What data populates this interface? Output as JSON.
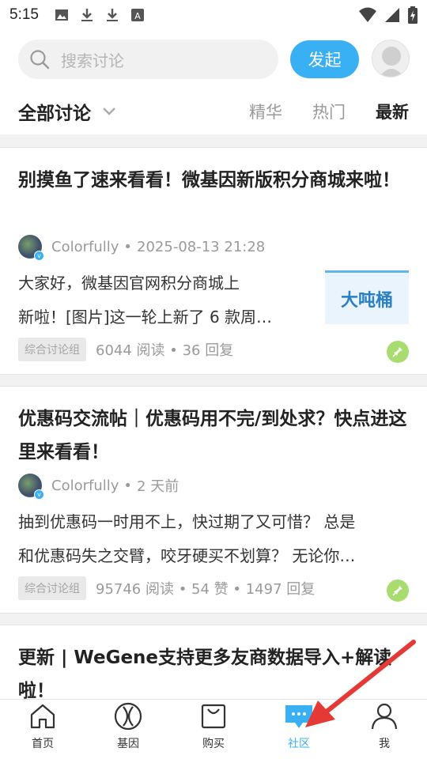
{
  "status_bar": {
    "time": "5:15"
  },
  "search": {
    "placeholder": "搜索讨论"
  },
  "header": {
    "launch_label": "发起"
  },
  "filter": {
    "all_label": "全部讨论",
    "tabs": [
      {
        "label": "精华",
        "active": false
      },
      {
        "label": "热门",
        "active": false
      },
      {
        "label": "最新",
        "active": true
      }
    ]
  },
  "posts": [
    {
      "title": "别摸鱼了速来看看！微基因新版积分商城来啦！",
      "author": "Colorfully",
      "time": "2025-08-13 21:28",
      "excerpt_line1": "大家好，微基因官网积分商城上",
      "excerpt_line2": "新啦！[图片]这一轮上新了 6 款周…",
      "thumb_text": "大吨桶",
      "tag": "综合讨论组",
      "stats": "6044 阅读 • 36 回复"
    },
    {
      "title": "优惠码交流帖｜优惠码用不完/到处求？快点进这里来看看！",
      "author": "Colorfully",
      "time": "2 天前",
      "excerpt_line1": "抽到优惠码一时用不上，快过期了又可惜？ 总是",
      "excerpt_line2": "和优惠码失之交臂，咬牙硬买不划算？ 无论你…",
      "tag": "综合讨论组",
      "stats": "95746 阅读 • 54 赞 • 1497 回复"
    },
    {
      "title": "更新 | WeGene支持更多友商数据导入+解读啦！"
    }
  ],
  "bottom_nav": [
    {
      "label": "首页",
      "icon": "home-icon",
      "active": false
    },
    {
      "label": "基因",
      "icon": "gene-icon",
      "active": false
    },
    {
      "label": "购买",
      "icon": "shopping-bag-icon",
      "active": false
    },
    {
      "label": "社区",
      "icon": "chat-bubble-icon",
      "active": true
    },
    {
      "label": "我",
      "icon": "user-icon",
      "active": false
    }
  ],
  "colors": {
    "accent": "#3ab0f4",
    "pin": "#a8dc6e",
    "arrow": "#e53935"
  }
}
